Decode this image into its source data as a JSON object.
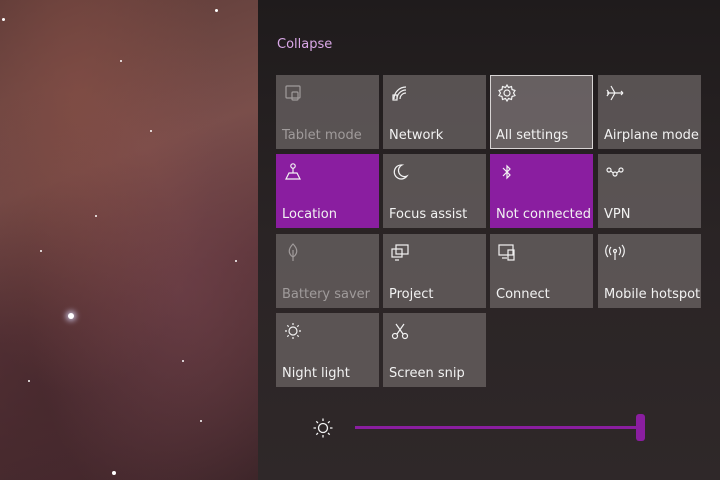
{
  "panel": {
    "collapse_label": "Collapse"
  },
  "tiles": [
    {
      "label": "Tablet mode",
      "icon": "tablet-mode-icon",
      "state": "disabled"
    },
    {
      "label": "Network",
      "icon": "network-icon",
      "state": "off"
    },
    {
      "label": "All settings",
      "icon": "gear-icon",
      "state": "selected"
    },
    {
      "label": "Airplane mode",
      "icon": "airplane-icon",
      "state": "off"
    },
    {
      "label": "Location",
      "icon": "location-icon",
      "state": "on"
    },
    {
      "label": "Focus assist",
      "icon": "moon-icon",
      "state": "off"
    },
    {
      "label": "Not connected",
      "icon": "bluetooth-icon",
      "state": "on"
    },
    {
      "label": "VPN",
      "icon": "vpn-icon",
      "state": "off"
    },
    {
      "label": "Battery saver",
      "icon": "battery-saver-icon",
      "state": "disabled"
    },
    {
      "label": "Project",
      "icon": "project-icon",
      "state": "off"
    },
    {
      "label": "Connect",
      "icon": "connect-icon",
      "state": "off"
    },
    {
      "label": "Mobile hotspot",
      "icon": "mobile-hotspot-icon",
      "state": "off"
    },
    {
      "label": "Night light",
      "icon": "night-light-icon",
      "state": "off"
    },
    {
      "label": "Screen snip",
      "icon": "screen-snip-icon",
      "state": "off"
    }
  ],
  "brightness": {
    "icon": "brightness-icon",
    "level_percent": 100
  },
  "colors": {
    "accent": "#8a1ea0",
    "collapse_link": "#d9a7e7",
    "tile_off": "#6e6667",
    "tile_text": "#f2f2f2",
    "tile_text_disabled": "#a09b9b"
  }
}
